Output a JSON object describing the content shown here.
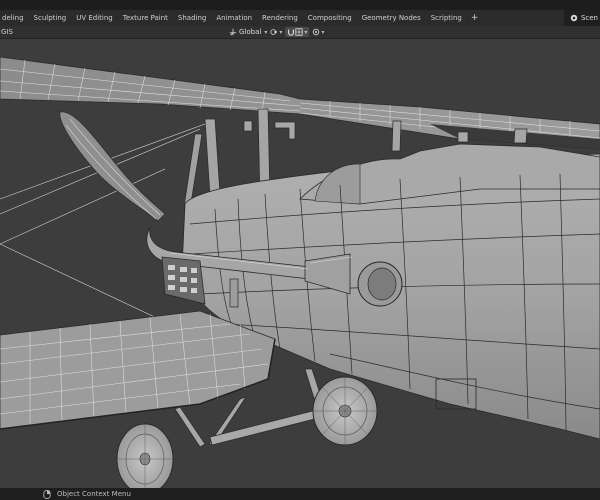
{
  "workspace_tabs": [
    "deling",
    "Sculpting",
    "UV Editing",
    "Texture Paint",
    "Shading",
    "Animation",
    "Rendering",
    "Compositing",
    "Geometry Nodes",
    "Scripting"
  ],
  "add_tab_label": "+",
  "scene_label": "Scen",
  "header": {
    "mode_label": "GIS",
    "transform_orientation": "Global"
  },
  "status_bar": {
    "hint": "Object Context Menu"
  },
  "colors": {
    "viewport_bg": "#3d3d3d",
    "mesh_surface": "#9a9a9a",
    "wireframe": "#e0e0e0"
  }
}
